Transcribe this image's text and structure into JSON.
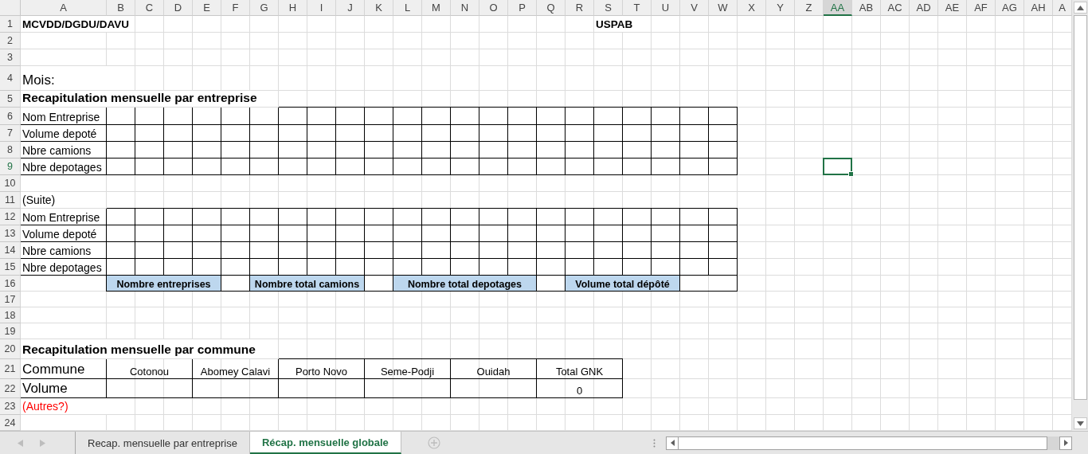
{
  "column_headers": [
    {
      "label": "A",
      "selected": false
    },
    {
      "label": "B",
      "selected": false
    },
    {
      "label": "C",
      "selected": false
    },
    {
      "label": "D",
      "selected": false
    },
    {
      "label": "E",
      "selected": false
    },
    {
      "label": "F",
      "selected": false
    },
    {
      "label": "G",
      "selected": false
    },
    {
      "label": "H",
      "selected": false
    },
    {
      "label": "I",
      "selected": false
    },
    {
      "label": "J",
      "selected": false
    },
    {
      "label": "K",
      "selected": false
    },
    {
      "label": "L",
      "selected": false
    },
    {
      "label": "M",
      "selected": false
    },
    {
      "label": "N",
      "selected": false
    },
    {
      "label": "O",
      "selected": false
    },
    {
      "label": "P",
      "selected": false
    },
    {
      "label": "Q",
      "selected": false
    },
    {
      "label": "R",
      "selected": false
    },
    {
      "label": "S",
      "selected": false
    },
    {
      "label": "T",
      "selected": false
    },
    {
      "label": "U",
      "selected": false
    },
    {
      "label": "V",
      "selected": false
    },
    {
      "label": "W",
      "selected": false
    },
    {
      "label": "X",
      "selected": false
    },
    {
      "label": "Y",
      "selected": false
    },
    {
      "label": "Z",
      "selected": false
    },
    {
      "label": "AA",
      "selected": true
    },
    {
      "label": "AB",
      "selected": false
    },
    {
      "label": "AC",
      "selected": false
    },
    {
      "label": "AD",
      "selected": false
    },
    {
      "label": "AE",
      "selected": false
    },
    {
      "label": "AF",
      "selected": false
    },
    {
      "label": "AG",
      "selected": false
    },
    {
      "label": "AH",
      "selected": false
    },
    {
      "label": "A",
      "selected": false
    }
  ],
  "row_headers": [
    {
      "label": "1",
      "selected": false
    },
    {
      "label": "2",
      "selected": false
    },
    {
      "label": "3",
      "selected": false
    },
    {
      "label": "4",
      "selected": false
    },
    {
      "label": "5",
      "selected": false
    },
    {
      "label": "6",
      "selected": false
    },
    {
      "label": "7",
      "selected": false
    },
    {
      "label": "8",
      "selected": false
    },
    {
      "label": "9",
      "selected": true
    },
    {
      "label": "10",
      "selected": false
    },
    {
      "label": "11",
      "selected": false
    },
    {
      "label": "12",
      "selected": false
    },
    {
      "label": "13",
      "selected": false
    },
    {
      "label": "14",
      "selected": false
    },
    {
      "label": "15",
      "selected": false
    },
    {
      "label": "16",
      "selected": false
    },
    {
      "label": "17",
      "selected": false
    },
    {
      "label": "18",
      "selected": false
    },
    {
      "label": "19",
      "selected": false
    },
    {
      "label": "20",
      "selected": false
    },
    {
      "label": "21",
      "selected": false
    },
    {
      "label": "22",
      "selected": false
    },
    {
      "label": "23",
      "selected": false
    },
    {
      "label": "24",
      "selected": false
    }
  ],
  "header": {
    "left": "MCVDD/DGDU/DAVU",
    "right": "USPAB"
  },
  "month_label": "Mois:",
  "company_summary": {
    "title": "Recapitulation mensuelle par entreprise",
    "row_labels": [
      "Nom Entreprise",
      "Volume depoté",
      "Nbre camions",
      "Nbre depotages"
    ],
    "continuation_label": "(Suite)",
    "continuation_row_labels": [
      "Nom Entreprise",
      "Volume depoté",
      "Nbre camions",
      "Nbre depotages"
    ],
    "totals": [
      "Nombre entreprises",
      "Nombre total camions",
      "Nombre total depotages",
      "Volume total dépôté"
    ]
  },
  "commune_summary": {
    "title": "Recapitulation mensuelle par commune",
    "row_labels": [
      "Commune",
      "Volume"
    ],
    "communes": [
      {
        "name": "Cotonou"
      },
      {
        "name": "Abomey Calavi"
      },
      {
        "name": "Porto Novo"
      },
      {
        "name": "Seme-Podji"
      },
      {
        "name": "Ouidah"
      },
      {
        "name": "Total GNK",
        "volume": "0"
      }
    ],
    "note": "(Autres?)"
  },
  "sheet_tabs": [
    {
      "label": "Recap. mensuelle par entreprise",
      "selected": false
    },
    {
      "label": "Récap. mensuelle globale",
      "selected": true
    }
  ]
}
